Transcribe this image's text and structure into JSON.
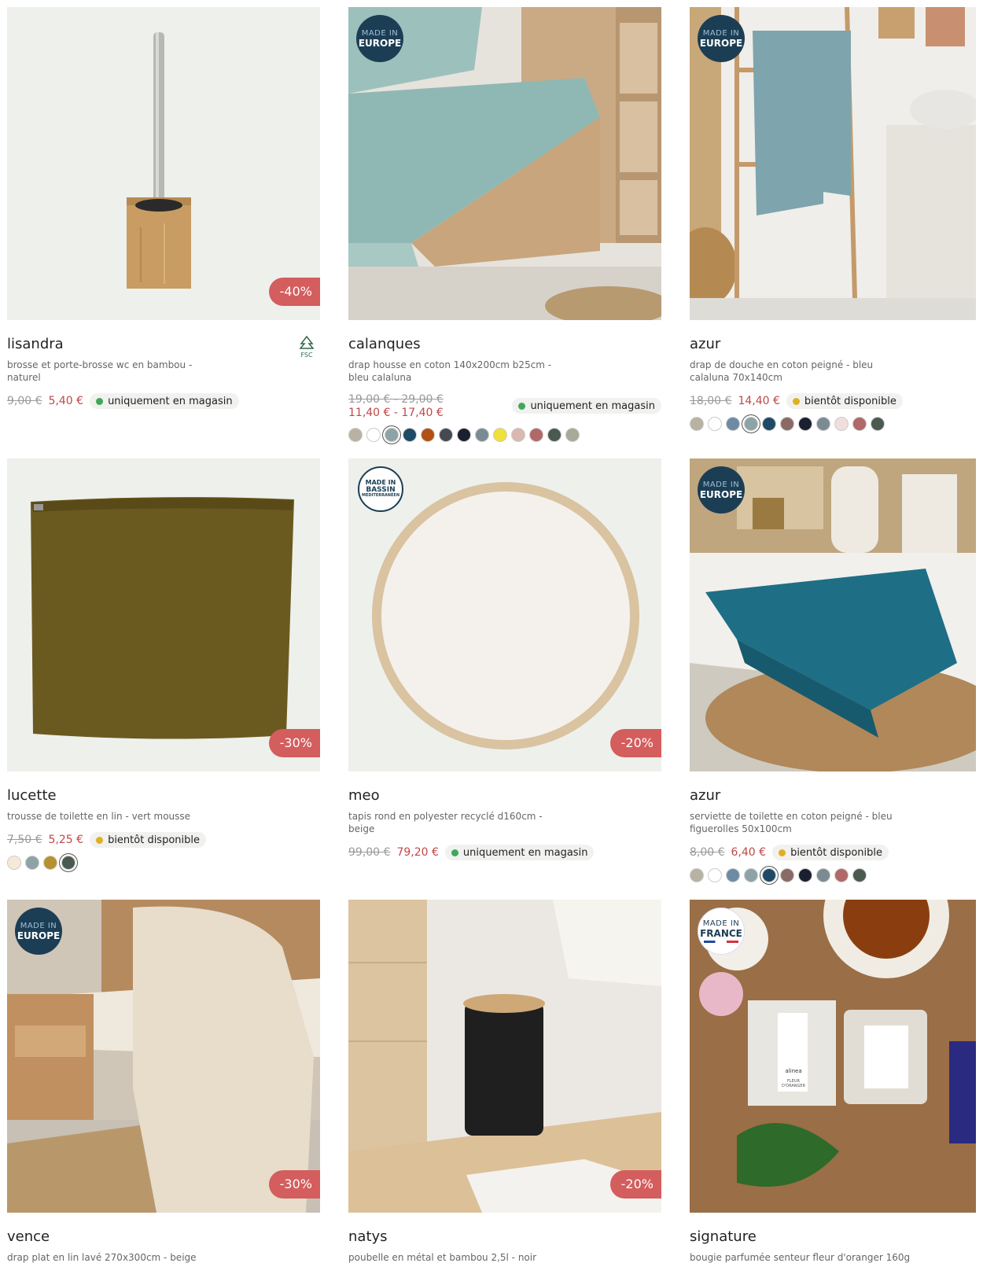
{
  "products": [
    {
      "name": "lisandra",
      "desc": "brosse et porte-brosse wc en bambou - naturel",
      "price_old": "9,00 €",
      "price_new": "5,40 €",
      "availability": "uniquement en magasin",
      "availability_color": "#3fa85a",
      "discount": "-40%",
      "label_icon": "fsc-tree-icon",
      "label_text": "FSC"
    },
    {
      "name": "calanques",
      "desc": "drap housse en coton 140x200cm b25cm - bleu calaluna",
      "badge_l1": "MADE IN",
      "badge_l2": "EUROPE",
      "price_old": "19,00 € - 29,00 €",
      "price_new": "11,40 € - 17,40 €",
      "availability": "uniquement en magasin",
      "availability_color": "#3fa85a",
      "swatches": [
        "#b7b2a2",
        "#ffffff",
        "#8da3a5",
        "#1e4a66",
        "#b25014",
        "#454a52",
        "#1a2030",
        "#7b8b94",
        "#f0e03a",
        "#d9b8b0",
        "#b06868",
        "#4a5a50",
        "#a8aa98"
      ]
    },
    {
      "name": "azur",
      "desc": "drap de douche en coton peigné - bleu calaluna 70x140cm",
      "badge_l1": "MADE IN",
      "badge_l2": "EUROPE",
      "price_old": "18,00 €",
      "price_new": "14,40 €",
      "availability": "bientôt disponible",
      "availability_color": "#e0b020",
      "swatches": [
        "#b7b2a2",
        "#ffffff",
        "#6e8aa5",
        "#8da3a5",
        "#1e4a66",
        "#8a6a64",
        "#1a2030",
        "#7b8b94",
        "#f0dede",
        "#b06868",
        "#4a5a50"
      ]
    },
    {
      "name": "lucette",
      "desc": "trousse de toilette en lin - vert mousse",
      "price_old": "7,50 €",
      "price_new": "5,25 €",
      "availability": "bientôt disponible",
      "availability_color": "#e0b020",
      "discount": "-30%",
      "swatches": [
        "#f6e9d8",
        "#8da3a5",
        "#b89030",
        "#4a5a50"
      ]
    },
    {
      "name": "meo",
      "desc": "tapis rond en polyester recyclé d160cm - beige",
      "badge_l1": "MADE IN",
      "badge_l2": "BASSIN",
      "badge_l3": "MÉDITERRANÉEN",
      "price_old": "99,00 €",
      "price_new": "79,20 €",
      "availability": "uniquement en magasin",
      "availability_color": "#3fa85a",
      "discount": "-20%"
    },
    {
      "name": "azur",
      "desc": "serviette de toilette en coton peigné - bleu figuerolles 50x100cm",
      "badge_l1": "MADE IN",
      "badge_l2": "EUROPE",
      "price_old": "8,00 €",
      "price_new": "6,40 €",
      "availability": "bientôt disponible",
      "availability_color": "#e0b020",
      "swatches": [
        "#b7b2a2",
        "#ffffff",
        "#6e8aa5",
        "#8da3a5",
        "#1e4a66",
        "#8a6a64",
        "#1a2030",
        "#7b8b94",
        "#b06868",
        "#4a5a50"
      ]
    },
    {
      "name": "vence",
      "desc": "drap plat en lin lavé 270x300cm - beige",
      "badge_l1": "MADE IN",
      "badge_l2": "EUROPE",
      "discount": "-30%"
    },
    {
      "name": "natys",
      "desc": "poubelle en métal et bambou 2,5l - noir",
      "discount": "-20%"
    },
    {
      "name": "signature",
      "desc": "bougie parfumée senteur fleur d'oranger 160g",
      "badge_l1": "MADE IN",
      "badge_l2": "FRANCE",
      "brand_label": "alinea",
      "box_text": "FLEUR D'ORANGER"
    }
  ]
}
